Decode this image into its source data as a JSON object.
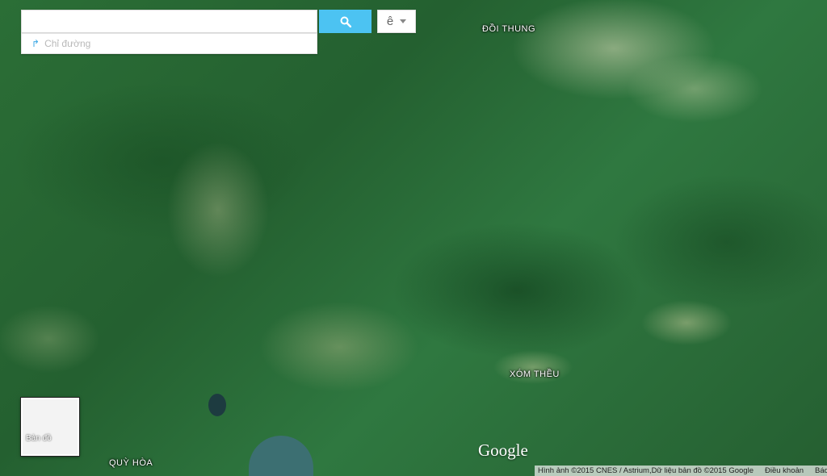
{
  "search": {
    "placeholder": "",
    "value": ""
  },
  "directions": {
    "label": "Chỉ đường",
    "icon": "directions-arrow-icon"
  },
  "search_button": {
    "icon": "search-icon",
    "color": "#4cc3f2"
  },
  "language_button": {
    "label": "ê"
  },
  "places": [
    {
      "name": "ĐỒI THUNG"
    },
    {
      "name": "XÓM THỀU"
    },
    {
      "name": "QUỲ HÒA"
    }
  ],
  "map_type_control": {
    "label": "Bản đồ"
  },
  "logo": {
    "text": "Google"
  },
  "attribution": {
    "imagery": "Hình ảnh ©2015 CNES / Astrium,Dữ liệu bản đồ ©2015 Google",
    "terms": "Điều khoản",
    "report": "Báo má"
  }
}
